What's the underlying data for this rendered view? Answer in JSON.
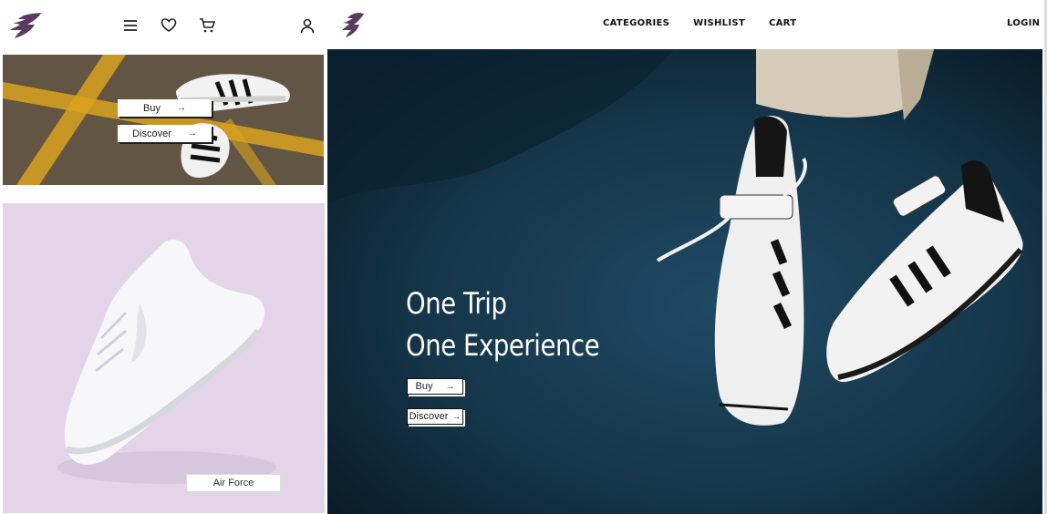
{
  "brand": {
    "logo_icon": "brand-logo-icon",
    "accent": "#5b3a5f"
  },
  "mobile": {
    "header_icons": [
      "menu-icon",
      "heart-icon",
      "cart-icon",
      "user-icon"
    ],
    "card_top": {
      "buy_label": "Buy",
      "discover_label": "Discover",
      "arrow": "→"
    },
    "card_bottom": {
      "label": "Air Force"
    }
  },
  "desktop": {
    "nav": {
      "categories": "CATEGORIES",
      "wishlist": "WISHLIST",
      "cart": "CART",
      "login": "LOGIN"
    },
    "hero": {
      "title_line1": "One Trip",
      "title_line2": "One Experience",
      "buy_label": "Buy",
      "discover_label": "Discover",
      "arrow": "→"
    }
  }
}
